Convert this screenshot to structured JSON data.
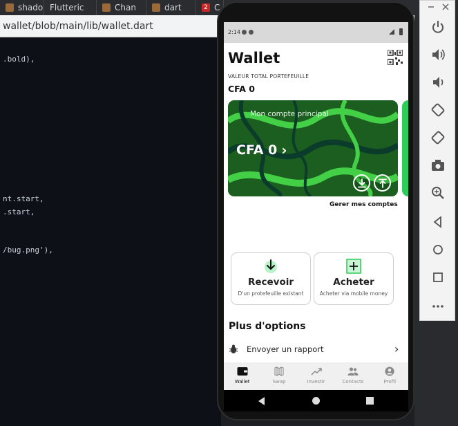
{
  "browser": {
    "tabs": [
      {
        "label": "shado",
        "icon": "tab-favicon"
      },
      {
        "label": "Flutteric",
        "icon": "tab-favicon"
      },
      {
        "label": "Chan",
        "icon": "tab-favicon"
      },
      {
        "label": "dart",
        "icon": "tab-favicon"
      },
      {
        "label": "C",
        "badge": "2",
        "icon": "tab-favicon"
      }
    ],
    "url": "wallet/blob/main/lib/wallet.dart"
  },
  "code": {
    "lines": [
      ".bold),",
      "nt.start,",
      ".start,",
      "/bug.png'),"
    ]
  },
  "app": {
    "status_time": "2:14",
    "title": "Wallet",
    "portfolio_caption": "VALEUR TOTAL PORTEFEUILLE",
    "portfolio_total": "CFA 0",
    "card": {
      "account_name": "Mon compte principal",
      "balance": "CFA 0",
      "balance_chevron": "›",
      "download_icon": "download-icon",
      "upload_icon": "upload-icon",
      "colors": {
        "base": "#1b5e20",
        "swirl": "#43d047",
        "dark": "#0b3b2a"
      }
    },
    "manage_accounts": "Gerer mes comptes",
    "actions": [
      {
        "label": "Recevoir",
        "sublabel": "D'un protefeuille existant",
        "icon": "receive-icon"
      },
      {
        "label": "Acheter",
        "sublabel": "Acheter via mobile money",
        "icon": "buy-plus-icon"
      }
    ],
    "more_options_title": "Plus d'options",
    "report": {
      "label": "Envoyer un rapport",
      "icon": "bug-icon",
      "chevron": "›"
    },
    "nav": [
      {
        "label": "Wallet",
        "icon": "wallet-icon",
        "active": true
      },
      {
        "label": "Swap",
        "icon": "swap-icon",
        "active": false
      },
      {
        "label": "Investir",
        "icon": "trending-icon",
        "active": false
      },
      {
        "label": "Contacts",
        "icon": "contacts-icon",
        "active": false
      },
      {
        "label": "Profil",
        "icon": "profile-icon",
        "active": false
      }
    ],
    "accent": "#2ecc59"
  },
  "emulator_toolbar": {
    "buttons": [
      "power-icon",
      "volume-up-icon",
      "volume-down-icon",
      "rotate-left-icon",
      "rotate-right-icon",
      "camera-icon",
      "zoom-icon",
      "back-icon",
      "home-icon",
      "overview-icon",
      "more-icon"
    ]
  }
}
